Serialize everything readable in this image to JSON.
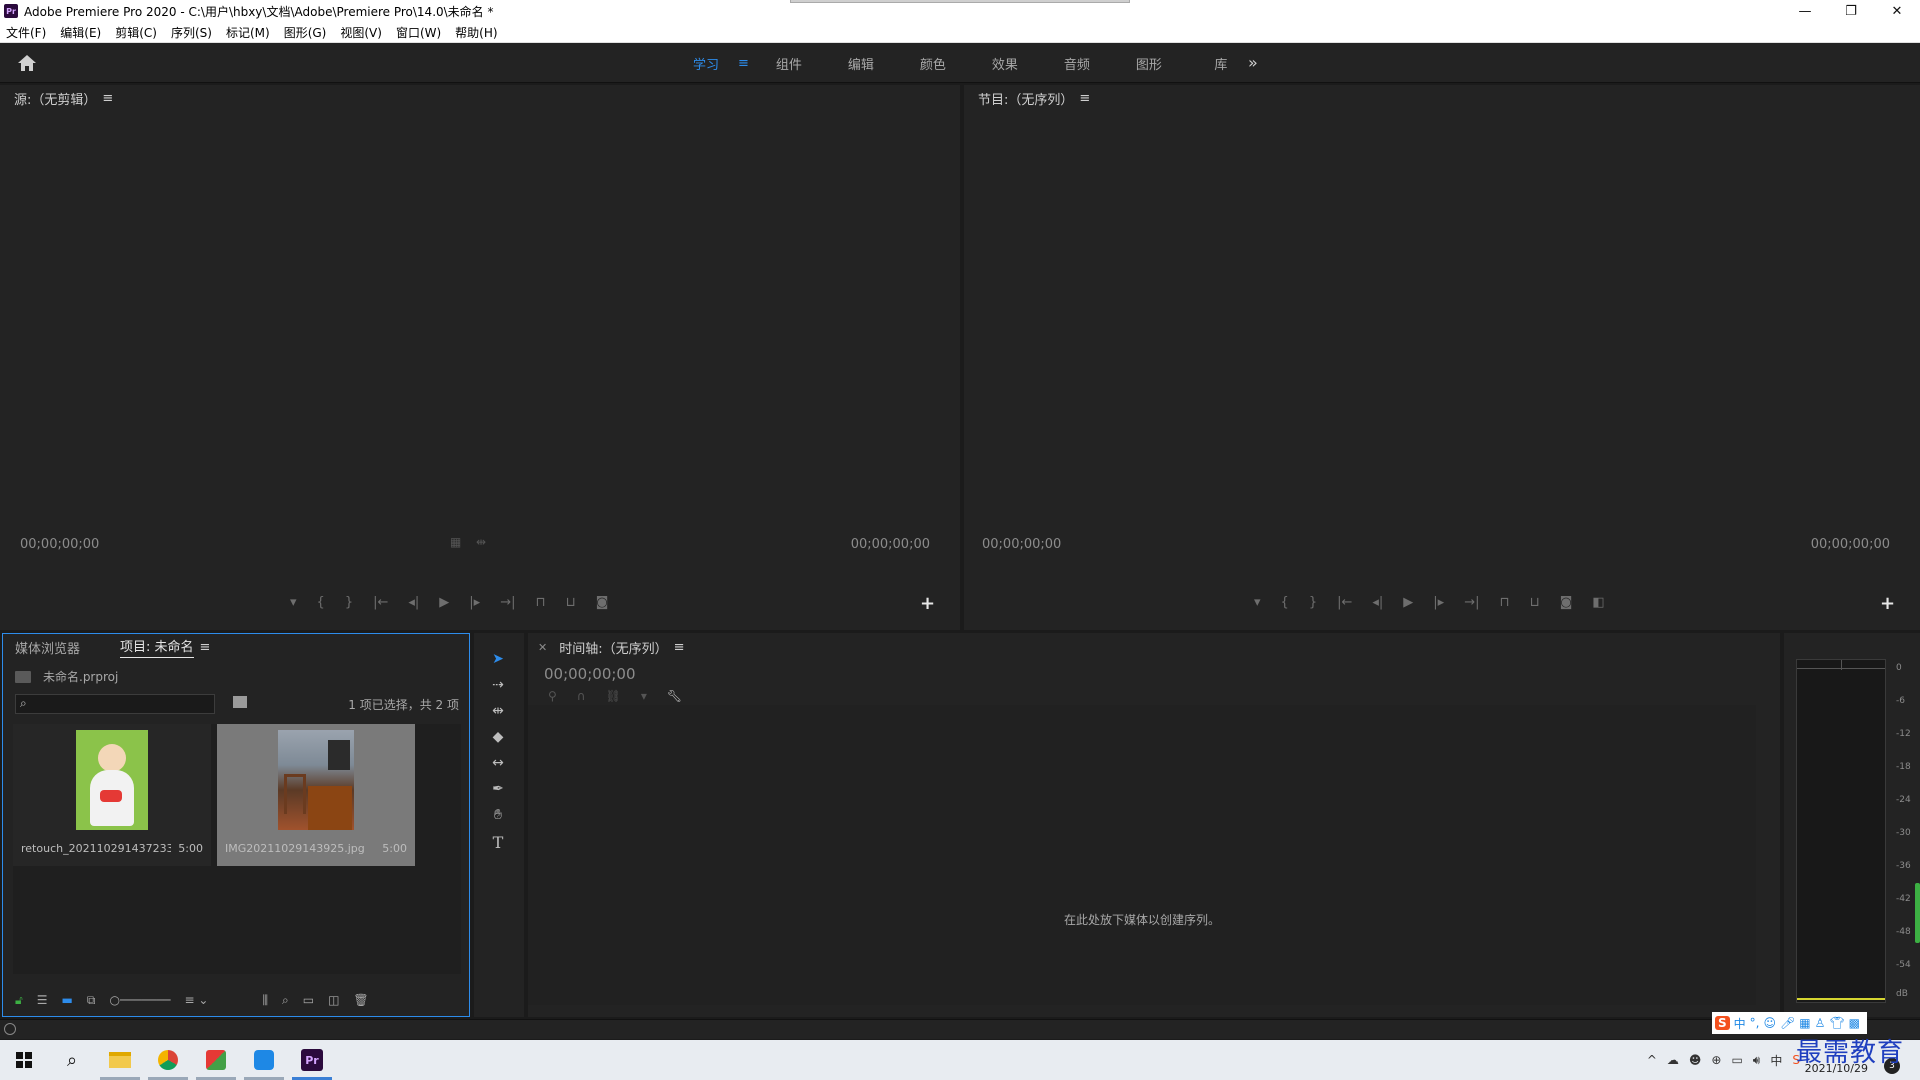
{
  "window": {
    "title": "Adobe Premiere Pro 2020 - C:\\用户\\hbxy\\文档\\Adobe\\Premiere Pro\\14.0\\未命名 *",
    "app_logo": "Pr"
  },
  "menu": [
    "文件(F)",
    "编辑(E)",
    "剪辑(C)",
    "序列(S)",
    "标记(M)",
    "图形(G)",
    "视图(V)",
    "窗口(W)",
    "帮助(H)"
  ],
  "workspaces": {
    "tabs": [
      "学习",
      "组件",
      "编辑",
      "颜色",
      "效果",
      "音频",
      "图形",
      "库"
    ],
    "active": "学习",
    "menu_glyph": "≡",
    "more": "»"
  },
  "source_monitor": {
    "title": "源:（无剪辑）",
    "timecode_left": "00;00;00;00",
    "timecode_right": "00;00;00;00"
  },
  "program_monitor": {
    "title": "节目:（无序列）",
    "timecode_left": "00;00;00;00",
    "timecode_right": "00;00;00;00"
  },
  "project_panel": {
    "tabs": [
      "媒体浏览器",
      "项目: 未命名"
    ],
    "project_file": "未命名.prproj",
    "selection_count": "1 项已选择，共 2 项",
    "clips": [
      {
        "name": "retouch_2021102914372334...",
        "duration": "5:00"
      },
      {
        "name": "IMG20211029143925.jpg",
        "duration": "5:00"
      }
    ]
  },
  "timeline": {
    "title": "时间轴:（无序列）",
    "timecode": "00;00;00;00",
    "drop_message": "在此处放下媒体以创建序列。"
  },
  "audio_meter": {
    "scale": [
      "0",
      "-6",
      "-12",
      "-18",
      "-24",
      "-30",
      "-36",
      "-42",
      "-48",
      "-54",
      "dB"
    ]
  },
  "taskbar": {
    "date": "2021/10/29",
    "notification_count": "3"
  },
  "ime": {
    "logo": "S",
    "mode": "中"
  },
  "watermark": "最需教育",
  "colors": {
    "accent": "#2d8ceb",
    "panel_bg": "#232323",
    "meter_green": "#3cb043"
  }
}
